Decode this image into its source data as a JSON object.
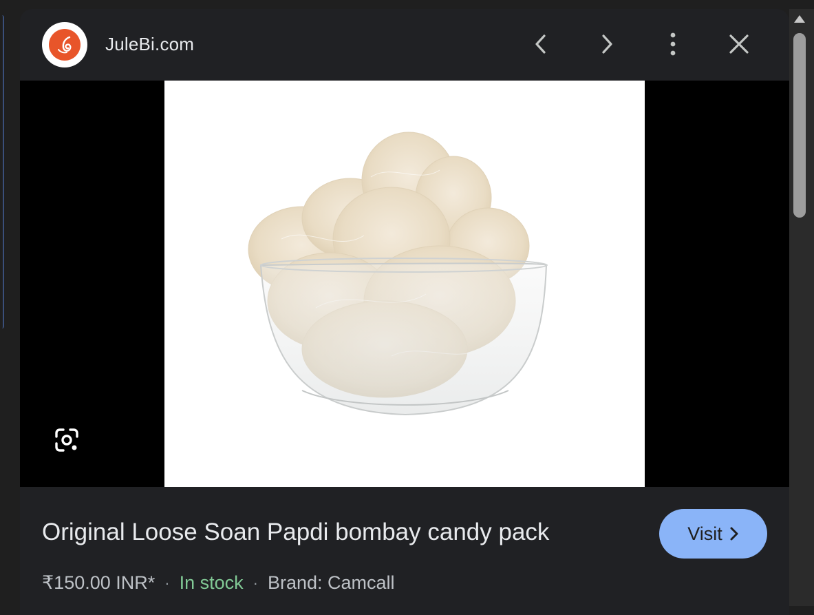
{
  "header": {
    "site_name": "JuleBi.com",
    "logo_icon": "julebi-logo-icon",
    "prev_icon": "chevron-left-icon",
    "next_icon": "chevron-right-icon",
    "more_icon": "more-vert-icon",
    "close_icon": "close-icon"
  },
  "image": {
    "lens_icon": "google-lens-icon"
  },
  "product": {
    "title": "Original Loose Soan Papdi bombay candy pack",
    "price": "₹150.00 INR*",
    "separator": "·",
    "availability": "In stock",
    "brand": "Brand: Camcall"
  },
  "visit_button": {
    "label": "Visit",
    "icon": "chevron-right-icon"
  },
  "colors": {
    "panel_bg": "#202124",
    "accent": "#8ab4f8",
    "in_stock": "#81c995",
    "logo": "#e8552a"
  }
}
